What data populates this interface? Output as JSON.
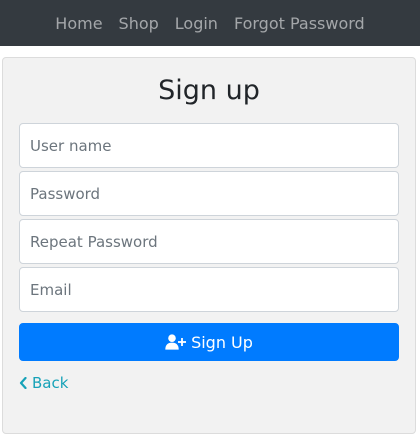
{
  "nav": {
    "items": [
      {
        "label": "Home"
      },
      {
        "label": "Shop"
      },
      {
        "label": "Login"
      },
      {
        "label": "Forgot Password"
      }
    ]
  },
  "form": {
    "title": "Sign up",
    "username": {
      "placeholder": "User name",
      "value": ""
    },
    "password": {
      "placeholder": "Password",
      "value": ""
    },
    "repeat_password": {
      "placeholder": "Repeat Password",
      "value": ""
    },
    "email": {
      "placeholder": "Email",
      "value": ""
    },
    "submit_label": "Sign Up",
    "submit_icon": "user-plus-icon",
    "back_label": "Back",
    "back_icon": "chevron-left-icon"
  },
  "colors": {
    "navbar_bg": "#343a40",
    "primary": "#007bff",
    "link": "#17a2b8",
    "card_bg": "#f2f2f2"
  }
}
